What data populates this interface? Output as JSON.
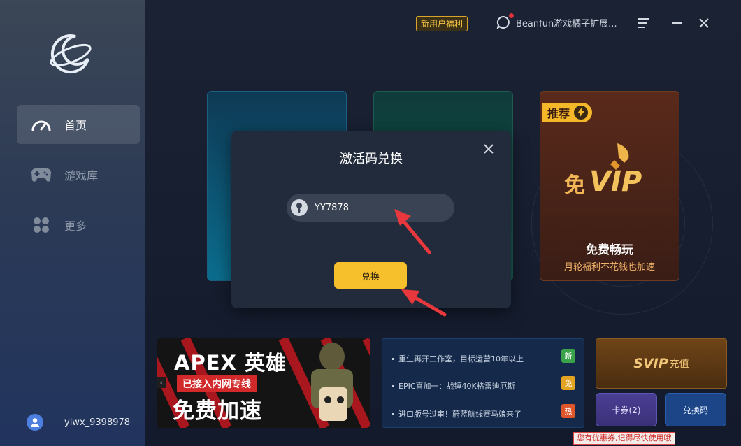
{
  "sidebar": {
    "items": [
      {
        "label": "首页",
        "icon": "speedometer-icon",
        "active": true
      },
      {
        "label": "游戏库",
        "icon": "gamepad-icon",
        "active": false
      },
      {
        "label": "更多",
        "icon": "grid-dots-icon",
        "active": false
      }
    ],
    "username": "ylwx_9398978"
  },
  "topbar": {
    "promo_label": "新用户福利",
    "message_text": "Beanfun游戏橘子扩展..."
  },
  "vip_card": {
    "tag": "推荐",
    "art_text": "免VIP",
    "title": "免费畅玩",
    "subtitle": "月轮福利不花钱也加速"
  },
  "modal": {
    "title": "激活码兑换",
    "code_value": "YY7878",
    "redeem_label": "兑换"
  },
  "apex_banner": {
    "line1": "APEX 英雄",
    "line2": "已接入内网专线",
    "line3": "免费加速",
    "prev": "‹"
  },
  "news": [
    {
      "text": "重生再开工作室，目标运营10年以上",
      "badge": "新",
      "badge_color": "#3aa34a"
    },
    {
      "text": "EPIC喜加一：战锤40K格雷迪厄斯",
      "badge": "免",
      "badge_color": "#e2a322"
    },
    {
      "text": "进口版号过审！蔚蓝航线赛马娘来了",
      "badge": "热",
      "badge_color": "#e0552a"
    }
  ],
  "actions": {
    "svip_big": "SVIP",
    "svip_small": "充值",
    "coupon_label": "卡券(2)",
    "exchange_label": "兑换码",
    "tip": "您有优惠券,记得尽快使用哦"
  },
  "colors": {
    "accent_yellow": "#f5c02c",
    "arrow_red": "#e8383d"
  }
}
